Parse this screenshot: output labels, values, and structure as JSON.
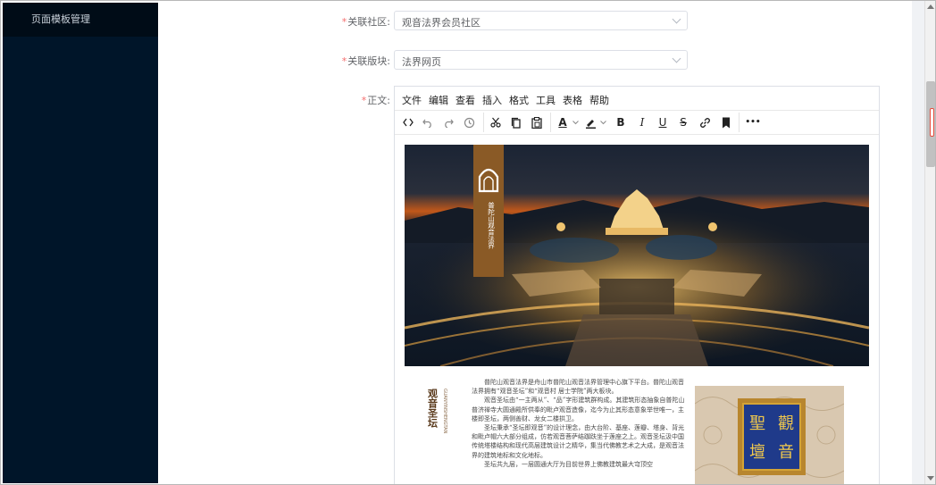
{
  "sidebar": {
    "items": [
      {
        "label": "页面模板管理"
      }
    ]
  },
  "form": {
    "community": {
      "label": "关联社区:",
      "value": "观音法界会员社区"
    },
    "section": {
      "label": "关联版块:",
      "value": "法界网页"
    },
    "content": {
      "label": "正文:"
    }
  },
  "editor": {
    "menu": [
      "文件",
      "编辑",
      "查看",
      "插入",
      "格式",
      "工具",
      "表格",
      "帮助"
    ],
    "toolbar": {
      "font_color": "A",
      "bold": "B",
      "italic": "I",
      "underline": "U",
      "strike": "S",
      "more": "•••"
    },
    "document": {
      "vertical_title": "观音圣坛",
      "vertical_pinyin": "GUANYINSHENGTAN",
      "paragraphs": [
        "普陀山观音法界是舟山市普陀山观音法界管理中心旗下平台。普陀山观音法界拥有“观音圣坛”和“观音村 居士学院”两大板块。",
        "观音圣坛由“一主两从”、“品”字形建筑群构成。其建筑形态抽象自普陀山普济禅寺大圆通殿所供奉的毗卢观音造像，迄今为止其形态意象举世唯一，主楼即圣坛，两侧善财、龙女二楼拱卫。",
        "圣坛秉承“圣坛即观音”的设计理念，由大台阶、基座、莲瓣、塔身、背光和毗卢帽六大部分组成，仿若观音菩萨结跏趺坐于莲座之上。观音圣坛汲中国传统塔楼结构和现代高层建筑设计之精华，集当代佛教艺术之大成，是观音法界的建筑地标和文化地标。",
        "圣坛共九层，一层圆通大厅为目前世界上佛教建筑最大穹顶空"
      ],
      "photo_logo_text": "普陀山观音法界",
      "plaque_chars": [
        "觀",
        "聖",
        "音",
        "壇"
      ]
    }
  },
  "colors": {
    "sidebar_bg": "#001529",
    "sidebar_active": "#000c17",
    "required": "#f56c6c",
    "logo_brown": "#8a5a26",
    "plaque_blue": "#1f3a8a",
    "plaque_gold": "#d4a437"
  },
  "icons": [
    "code-icon",
    "undo-icon",
    "redo-icon",
    "history-icon",
    "cut-icon",
    "copy-icon",
    "paste-icon",
    "font-color-icon",
    "highlight-icon",
    "link-icon",
    "bookmark-icon",
    "chevron-down-icon"
  ]
}
